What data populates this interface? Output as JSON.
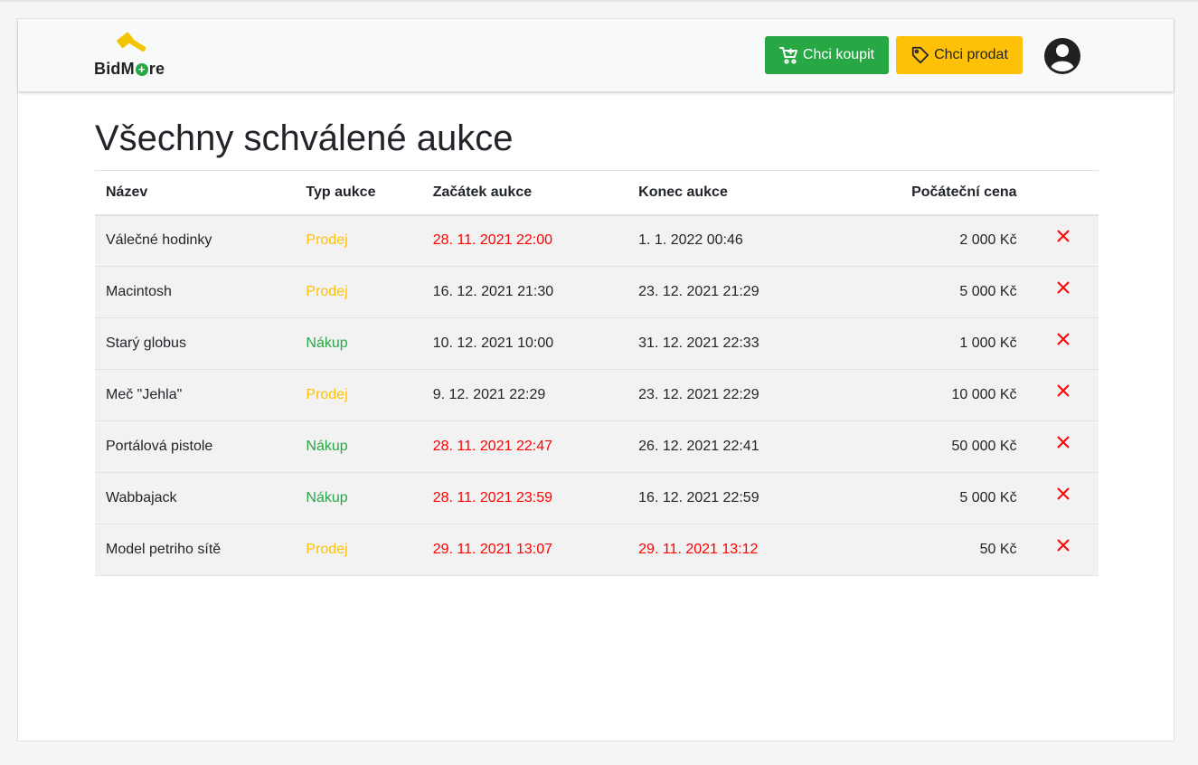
{
  "brand": {
    "logo_text_before": "BidM",
    "logo_text_plus": "+",
    "logo_text_after": "re"
  },
  "header": {
    "buy_button": "Chci koupit",
    "sell_button": "Chci prodat"
  },
  "page": {
    "title": "Všechny schválené aukce"
  },
  "table": {
    "headers": [
      "Název",
      "Typ aukce",
      "Začátek aukce",
      "Konec aukce",
      "Počáteční cena"
    ],
    "rows": [
      {
        "name": "Válečné hodinky",
        "type": "Prodej",
        "start": "28. 11. 2021 22:00",
        "end": "1. 1. 2022 00:46",
        "price": "2 000 Kč"
      },
      {
        "name": "Macintosh",
        "type": "Prodej",
        "start": "16. 12. 2021 21:30",
        "end": "23. 12. 2021 21:29",
        "price": "5 000 Kč"
      },
      {
        "name": "Starý globus",
        "type": "Nákup",
        "start": "10. 12. 2021 10:00",
        "end": "31. 12. 2021 22:33",
        "price": "1 000 Kč"
      },
      {
        "name": "Meč \"Jehla\"",
        "type": "Prodej",
        "start": "9. 12. 2021 22:29",
        "end": "23. 12. 2021 22:29",
        "price": "10 000 Kč"
      },
      {
        "name": "Portálová pistole",
        "type": "Nákup",
        "start": "28. 11. 2021 22:47",
        "end": "26. 12. 2021 22:41",
        "price": "50 000 Kč"
      },
      {
        "name": "Wabbajack",
        "type": "Nákup",
        "start": "28. 11. 2021 23:59",
        "end": "16. 12. 2021 22:59",
        "price": "5 000 Kč"
      },
      {
        "name": "Model petriho sítě",
        "type": "Prodej",
        "start": "29. 11. 2021 13:07",
        "end": "29. 11. 2021 13:12",
        "price": "50 Kč"
      }
    ]
  },
  "colors": {
    "buy": "#28a745",
    "sell": "#ffc107",
    "expired": "#ff0000",
    "delete": "#ff0000"
  },
  "icons": {
    "buy_button": "cart-icon",
    "sell_button": "tag-icon",
    "account": "user-circle-icon",
    "row_action": "close-icon"
  }
}
